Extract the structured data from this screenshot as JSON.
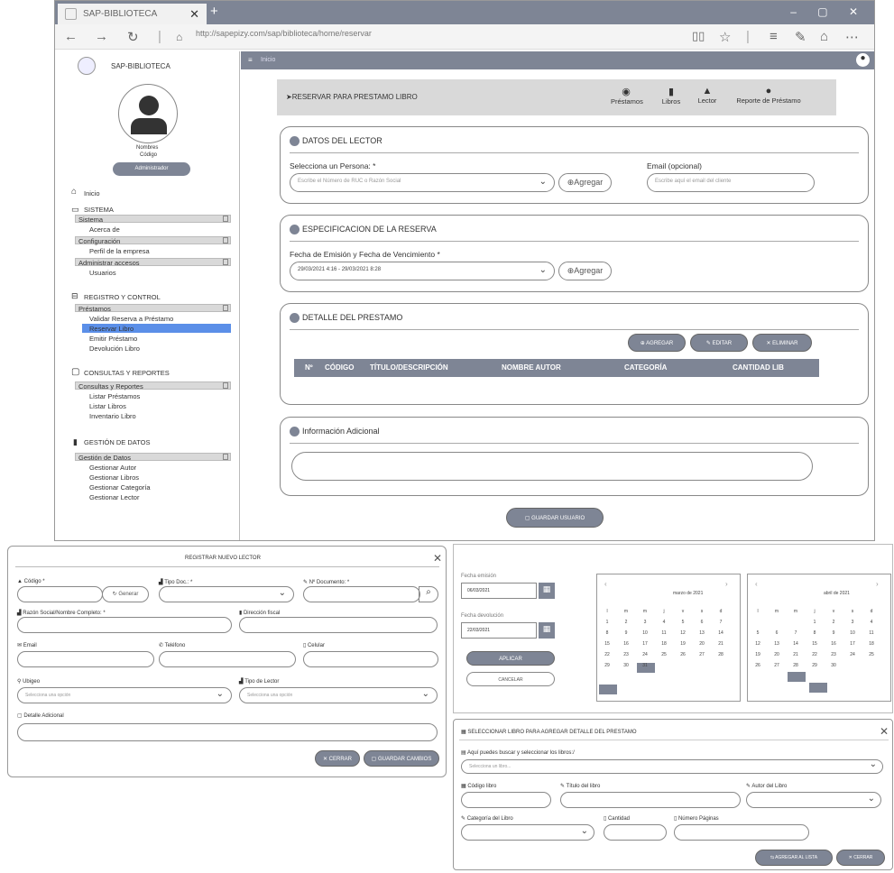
{
  "browser": {
    "tab_title": "SAP-BIBLIOTECA",
    "tab_close": "✕",
    "new_tab": "+",
    "window_controls": "– ▢ ✕",
    "url": "http://sapepizy.com/sap/biblioteca/home/reservar"
  },
  "sidebar": {
    "app_name": "SAP-BIBLIOTECA",
    "user_name": "Nombres",
    "user_code": "Código",
    "role_button": "Administrador",
    "inicio": "Inicio",
    "sistema": "SISTEMA",
    "sistema_group": "Sistema",
    "acerca": "Acerca de",
    "configuracion": "Configuración",
    "perfil": "Perfil de la empresa",
    "administrar": "Administrar accesos",
    "usuarios": "Usuarios",
    "registro": "REGISTRO Y CONTROL",
    "prestamos_group": "Préstamos",
    "validar": "Validar Reserva a Préstamo",
    "reservar": "Reservar Libro",
    "emitir": "Emitir Préstamo",
    "devolucion": "Devolución Libro",
    "consultas": "CONSULTAS Y REPORTES",
    "consultas_group": "Consultas y Reportes",
    "listar_prestamos": "Listar Préstamos",
    "listar_libros": "Listar Libros",
    "inventario": "Inventario Libro",
    "gestion": "GESTIÓN DE DATOS",
    "gestion_group": "Gestión de Datos",
    "gest_autor": "Gestionar Autor",
    "gest_libros": "Gestionar Libros",
    "gest_categoria": "Gestionar Categoría",
    "gest_lector": "Gestionar Lector"
  },
  "topnav": {
    "label": "Inicio"
  },
  "main": {
    "header_title": "RESERVAR PARA PRESTAMO LIBRO",
    "nav": [
      "Préstamos",
      "Libros",
      "Lector",
      "Reporte de Préstamo"
    ],
    "lector": {
      "title": "DATOS DEL LECTOR",
      "persona_label": "Selecciona un Persona: *",
      "persona_placeholder": "Escribe el Número de RUC o Razón Social",
      "agregar": "Agregar",
      "email_label": "Email (opcional)",
      "email_placeholder": "Escribe aquí el email del cliente"
    },
    "reserva": {
      "title": "ESPECIFICACION DE LA RESERVA",
      "fecha_label": "Fecha de Emisión y Fecha de Vencimiento *",
      "fecha_value": "29/03/2021 4:16 - 29/03/2021 8:28",
      "agregar": "Agregar"
    },
    "detalle": {
      "title": "DETALLE DEL PRESTAMO",
      "btn_agregar": "AGREGAR",
      "btn_editar": "EDITAR",
      "btn_eliminar": "ELIMINAR",
      "columns": [
        "Nº",
        "CÓDIGO",
        "TÍTULO/DESCRIPCIÓN",
        "NOMBRE AUTOR",
        "CATEGORÍA",
        "CANTIDAD LIB"
      ]
    },
    "adicional": {
      "title": "Información Adicional"
    },
    "guardar": "GUARDAR USUARIO"
  },
  "lector_dialog": {
    "title": "REGISTRAR NUEVO LECTOR",
    "codigo": "Código *",
    "generar": "Generar",
    "tipo_doc": "Tipo Doc.: *",
    "nro_doc": "Nº Documento: *",
    "razon": "Razón Social/Nombre Completo: *",
    "direccion": "Dirección fiscal",
    "email": "Email",
    "telefono": "Teléfono",
    "celular": "Celular",
    "ubigeo": "Ubigeo",
    "ubigeo_ph": "Selecciona una opción",
    "tipo_lector": "Tipo de Lector",
    "tipo_lector_ph": "Selecciona una opción",
    "detalle": "Detalle Adicional",
    "cerrar": "CERRAR",
    "guardar": "GUARDAR CAMBIOS"
  },
  "date_dialog": {
    "fecha_emision_label": "Fecha emisión",
    "fecha_emision": "06/03/2021",
    "fecha_devolucion_label": "Fecha devolución",
    "fecha_devolucion": "22/03/2021",
    "aplicar": "APLICAR",
    "cancelar": "CANCELAR",
    "month1": "marzo de 2021",
    "month2": "abril de 2021",
    "weekdays": [
      "l",
      "m",
      "m",
      "j",
      "v",
      "s",
      "d"
    ],
    "march_days": [
      "1",
      "2",
      "3",
      "4",
      "5",
      "6",
      "7",
      "8",
      "9",
      "10",
      "11",
      "12",
      "13",
      "14",
      "15",
      "16",
      "17",
      "18",
      "19",
      "20",
      "21",
      "22",
      "23",
      "24",
      "25",
      "26",
      "27",
      "28",
      "29",
      "30",
      "31"
    ],
    "april_days": [
      "1",
      "2",
      "3",
      "4",
      "5",
      "6",
      "7",
      "8",
      "9",
      "10",
      "11",
      "12",
      "13",
      "14",
      "15",
      "16",
      "17",
      "18",
      "19",
      "20",
      "21",
      "22",
      "23",
      "24",
      "25",
      "26",
      "27",
      "28",
      "29",
      "30"
    ]
  },
  "libro_dialog": {
    "title": "SELECCIONAR LIBRO PARA AGREGAR DETALLE DEL PRESTAMO",
    "buscar_label": "Aquí puedes buscar y seleccionar los libros:/",
    "buscar_ph": "Selecciona un libro...",
    "codigo": "Código libro",
    "titulo": "Título del libro",
    "autor": "Autor del Libro",
    "categoria": "Categoría del Libro",
    "cantidad": "Cantidad",
    "paginas": "Número Páginas",
    "agregar": "AGREGAR AL LISTA",
    "cerrar": "CERRAR"
  }
}
